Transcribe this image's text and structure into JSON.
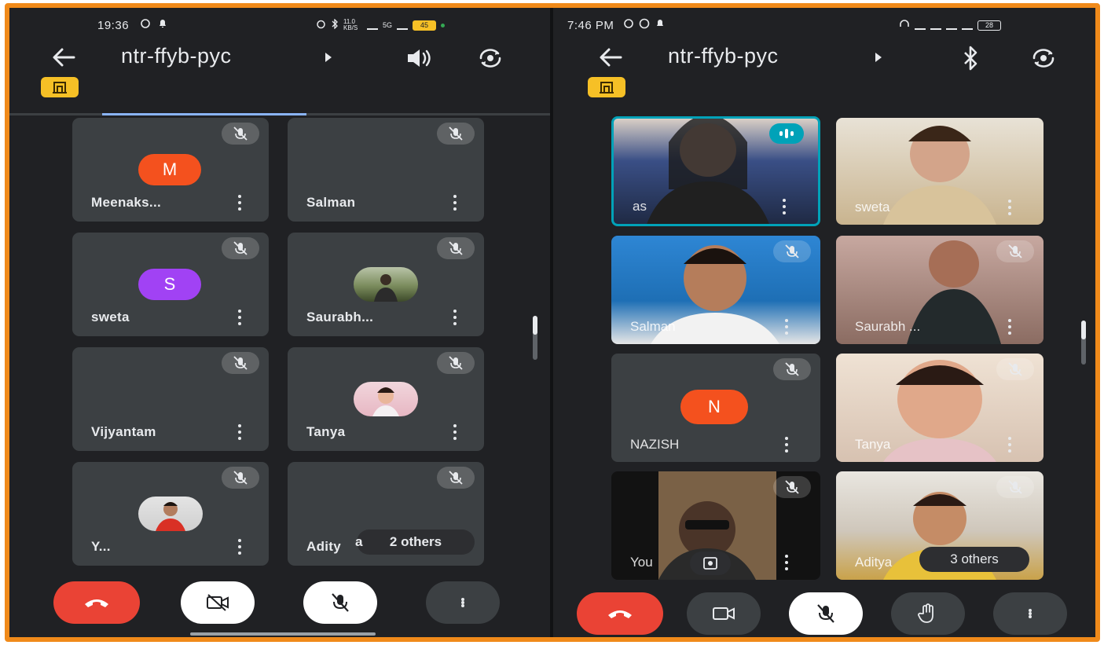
{
  "left_phone": {
    "status": {
      "time": "19:36",
      "speed": "11.0 KB/S",
      "signal_label": "5G",
      "battery": "45"
    },
    "header": {
      "title": "ntr-ffyb-pyc",
      "right_icon_1": "speaker-icon",
      "right_icon_2": "switch-camera-icon"
    },
    "tiles": [
      {
        "name": "Meenaks...",
        "avatar_letter": "M",
        "avatar_color": "#f4511e"
      },
      {
        "name": "Salman"
      },
      {
        "name": "sweta",
        "avatar_letter": "S",
        "avatar_color": "#a142f4"
      },
      {
        "name": "Saurabh...",
        "avatar": "photo"
      },
      {
        "name": "Vijyantam"
      },
      {
        "name": "Tanya",
        "avatar": "photo"
      },
      {
        "name": "Y...",
        "avatar": "photo"
      },
      {
        "name": "Adity",
        "name_suffix": "a",
        "others_label": "2 others"
      }
    ],
    "controls": [
      "end-call",
      "camera-off",
      "mic-off",
      "more-options"
    ]
  },
  "right_phone": {
    "status": {
      "time": "7:46 PM",
      "battery": "28"
    },
    "header": {
      "title": "ntr-ffyb-pyc",
      "right_icon_1": "bluetooth-icon",
      "right_icon_2": "switch-camera-icon"
    },
    "tiles": [
      {
        "name": "as",
        "video": true,
        "speaking": true,
        "tint": "#2f4a7a"
      },
      {
        "name": "sweta",
        "video": true,
        "tint": "#c9b48f"
      },
      {
        "name": "Salman",
        "video": true,
        "tint": "#1e6fb5"
      },
      {
        "name": "Saurabh ...",
        "video": true,
        "tint": "#a7867a"
      },
      {
        "name": "NAZISH",
        "avatar_letter": "N",
        "avatar_color": "#f4511e"
      },
      {
        "name": "Tanya",
        "video": true,
        "tint": "#d7c2b1"
      },
      {
        "name": "You",
        "video": true,
        "tint": "#2a2a2a"
      },
      {
        "name": "Aditya",
        "video": true,
        "tint": "#c9a24a",
        "others_label": "3 others"
      }
    ],
    "controls": [
      "end-call",
      "camera-on",
      "mic-off",
      "raise-hand",
      "more-options"
    ]
  },
  "colors": {
    "accent_border": "#f08a1a",
    "end_call": "#ea4335",
    "host_badge": "#f6c026",
    "tile_bg": "#3c4043",
    "speaking_border": "#00a2b8"
  }
}
